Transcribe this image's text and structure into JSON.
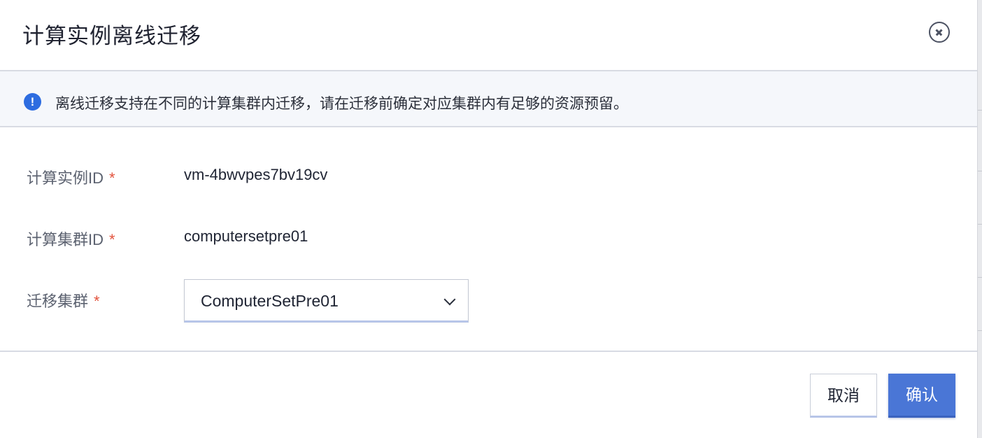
{
  "dialog": {
    "title": "计算实例离线迁移",
    "close_icon": "close-circle-icon"
  },
  "notice": {
    "icon": "info-icon",
    "icon_glyph": "!",
    "text": "离线迁移支持在不同的计算集群内迁移，请在迁移前确定对应集群内有足够的资源预留。"
  },
  "form": {
    "instance_id": {
      "label": "计算实例ID",
      "required": "*",
      "value": "vm-4bwvpes7bv19cv"
    },
    "cluster_id": {
      "label": "计算集群ID",
      "required": "*",
      "value": "computersetpre01"
    },
    "target_cluster": {
      "label": "迁移集群",
      "required": "*",
      "selected": "ComputerSetPre01"
    }
  },
  "footer": {
    "cancel_label": "取消",
    "confirm_label": "确认"
  },
  "colors": {
    "accent": "#4a76d6",
    "required": "#e2533d",
    "info": "#2d6ce0"
  }
}
